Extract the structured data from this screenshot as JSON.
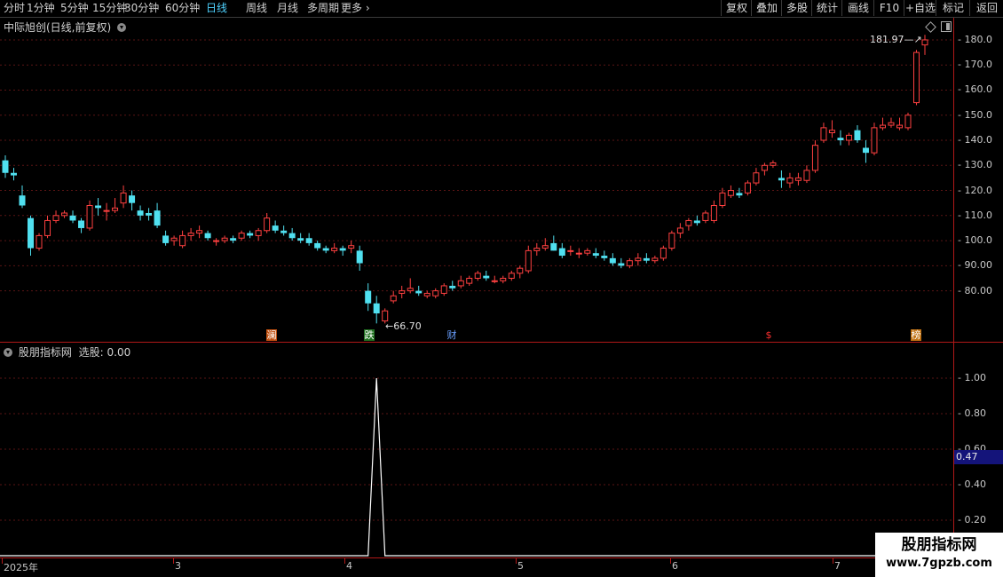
{
  "toolbar": {
    "periods": [
      "分时",
      "1分钟",
      "5分钟",
      "15分钟",
      "30分钟",
      "60分钟",
      "日线",
      "周线",
      "月线",
      "多周期",
      "更多"
    ],
    "active_period": "日线",
    "right_buttons": [
      "复权",
      "叠加",
      "多股",
      "统计",
      "画线",
      "F10",
      "+自选",
      "标记",
      "返回"
    ]
  },
  "main_chart": {
    "title": "中际旭创(日线,前复权)",
    "y_ticks": [
      "180.0",
      "170.0",
      "160.0",
      "150.0",
      "140.0",
      "130.0",
      "120.0",
      "110.0",
      "100.0",
      "90.00",
      "80.00"
    ],
    "high_label": "181.97",
    "low_label": "66.70",
    "markers": [
      {
        "text": "澜",
        "bg": "#c05010",
        "color": "#ffffff"
      },
      {
        "text": "跌",
        "bg": "#207020",
        "color": "#ffffff"
      },
      {
        "text": "财",
        "bg": "#000000",
        "color": "#6aa0ff"
      },
      {
        "text": "$",
        "bg": "#000000",
        "color": "#ff3030"
      },
      {
        "text": "榜",
        "bg": "#c07010",
        "color": "#ffffff"
      }
    ],
    "colors": {
      "up": "#ff4040",
      "down": "#50e0f0",
      "grid": "#5a1414"
    }
  },
  "indicator": {
    "name": "股朋指标网",
    "label": "选股: 0.00",
    "y_ticks": [
      "1.00",
      "0.80",
      "0.60",
      "0.40",
      "0.20"
    ],
    "current_value": "0.47",
    "signal_value": 1
  },
  "x_axis": {
    "labels": [
      "2025年",
      "3",
      "4",
      "5",
      "6",
      "7"
    ]
  },
  "watermark": {
    "line1": "股朋指标网",
    "line2": "www.7gpzb.com"
  },
  "chart_data": {
    "type": "candlestick",
    "series_ohlc": [
      [
        132,
        134,
        125,
        127
      ],
      [
        127,
        129,
        124,
        126
      ],
      [
        118,
        122,
        113,
        114
      ],
      [
        109,
        110,
        94,
        97
      ],
      [
        97,
        103,
        96,
        102
      ],
      [
        102,
        110,
        101,
        108
      ],
      [
        108,
        112,
        107,
        110
      ],
      [
        110,
        112,
        109,
        111
      ],
      [
        110,
        112,
        107,
        108
      ],
      [
        108,
        109,
        103,
        105
      ],
      [
        105,
        116,
        104,
        114
      ],
      [
        114,
        117,
        110,
        113
      ],
      [
        112,
        115,
        108,
        112
      ],
      [
        112,
        117,
        111,
        113
      ],
      [
        115,
        122,
        113,
        119
      ],
      [
        118,
        120,
        112,
        115
      ],
      [
        112,
        114,
        108,
        110
      ],
      [
        111,
        113,
        108,
        110
      ],
      [
        112,
        115,
        105,
        106
      ],
      [
        102,
        104,
        98,
        99
      ],
      [
        100,
        102,
        98,
        101
      ],
      [
        98,
        104,
        97,
        102
      ],
      [
        102,
        105,
        100,
        103
      ],
      [
        103,
        106,
        101,
        104
      ],
      [
        103,
        104,
        100,
        101
      ],
      [
        100,
        101,
        98,
        100
      ],
      [
        100,
        102,
        99,
        101
      ],
      [
        101,
        102,
        99,
        100
      ],
      [
        101,
        104,
        100,
        103
      ],
      [
        103,
        104,
        101,
        102
      ],
      [
        102,
        105,
        100,
        104
      ],
      [
        104,
        111,
        103,
        109
      ],
      [
        106,
        108,
        103,
        104
      ],
      [
        104,
        106,
        102,
        103
      ],
      [
        103,
        105,
        100,
        101
      ],
      [
        101,
        103,
        99,
        100
      ],
      [
        101,
        103,
        98,
        99
      ],
      [
        99,
        100,
        96,
        97
      ],
      [
        97,
        98,
        95,
        96
      ],
      [
        96,
        99,
        95,
        97
      ],
      [
        97,
        98,
        94,
        96
      ],
      [
        97,
        100,
        95,
        98
      ],
      [
        96,
        98,
        88,
        91
      ],
      [
        80,
        83,
        72,
        75
      ],
      [
        75,
        78,
        67,
        71
      ],
      [
        68,
        73,
        67,
        72
      ],
      [
        76,
        80,
        75,
        78
      ],
      [
        79,
        82,
        77,
        80
      ],
      [
        80,
        85,
        79,
        81
      ],
      [
        80,
        82,
        78,
        79
      ],
      [
        78,
        80,
        77,
        79
      ],
      [
        78,
        81,
        77,
        80
      ],
      [
        79,
        83,
        78,
        82
      ],
      [
        82,
        84,
        80,
        81
      ],
      [
        82,
        86,
        81,
        84
      ],
      [
        83,
        86,
        82,
        85
      ],
      [
        85,
        88,
        84,
        87
      ],
      [
        86,
        88,
        84,
        85
      ],
      [
        84,
        86,
        83,
        84
      ],
      [
        84,
        86,
        83,
        85
      ],
      [
        85,
        88,
        84,
        87
      ],
      [
        87,
        90,
        85,
        89
      ],
      [
        88,
        98,
        87,
        96
      ],
      [
        96,
        99,
        94,
        97
      ],
      [
        97,
        101,
        96,
        98
      ],
      [
        99,
        102,
        96,
        96
      ],
      [
        97,
        99,
        93,
        94
      ],
      [
        96,
        98,
        94,
        96
      ],
      [
        95,
        97,
        93,
        95
      ],
      [
        95,
        97,
        94,
        96
      ],
      [
        95,
        97,
        93,
        94
      ],
      [
        94,
        96,
        92,
        93
      ],
      [
        93,
        95,
        90,
        91
      ],
      [
        91,
        93,
        89,
        90
      ],
      [
        90,
        93,
        89,
        92
      ],
      [
        92,
        95,
        90,
        93
      ],
      [
        93,
        95,
        91,
        92
      ],
      [
        92,
        94,
        91,
        93
      ],
      [
        93,
        98,
        92,
        97
      ],
      [
        97,
        104,
        96,
        103
      ],
      [
        103,
        107,
        101,
        105
      ],
      [
        106,
        109,
        104,
        108
      ],
      [
        108,
        110,
        106,
        107
      ],
      [
        108,
        112,
        107,
        111
      ],
      [
        108,
        116,
        107,
        114
      ],
      [
        114,
        121,
        113,
        119
      ],
      [
        118,
        122,
        117,
        120
      ],
      [
        119,
        121,
        117,
        118
      ],
      [
        119,
        124,
        118,
        123
      ],
      [
        123,
        129,
        122,
        127
      ],
      [
        128,
        131,
        126,
        130
      ],
      [
        130,
        132,
        129,
        131
      ],
      [
        125,
        128,
        121,
        124
      ],
      [
        123,
        127,
        121,
        125
      ],
      [
        124,
        127,
        122,
        125
      ],
      [
        124,
        130,
        123,
        128
      ],
      [
        128,
        140,
        127,
        138
      ],
      [
        140,
        147,
        139,
        145
      ],
      [
        143,
        148,
        141,
        144
      ],
      [
        141,
        144,
        138,
        140
      ],
      [
        140,
        143,
        138,
        142
      ],
      [
        144,
        146,
        139,
        140
      ],
      [
        137,
        140,
        131,
        135
      ],
      [
        135,
        147,
        134,
        145
      ],
      [
        145,
        149,
        144,
        146
      ],
      [
        146,
        149,
        145,
        147
      ],
      [
        145,
        149,
        144,
        146
      ],
      [
        145,
        151,
        144,
        150
      ],
      [
        155,
        176,
        154,
        175
      ],
      [
        178,
        182,
        174,
        180
      ]
    ],
    "ylim": [
      65,
      186
    ],
    "indicator_series": {
      "values_zero_except_index": 44,
      "peak": 1.0,
      "ylim": [
        0,
        1.1
      ]
    }
  }
}
